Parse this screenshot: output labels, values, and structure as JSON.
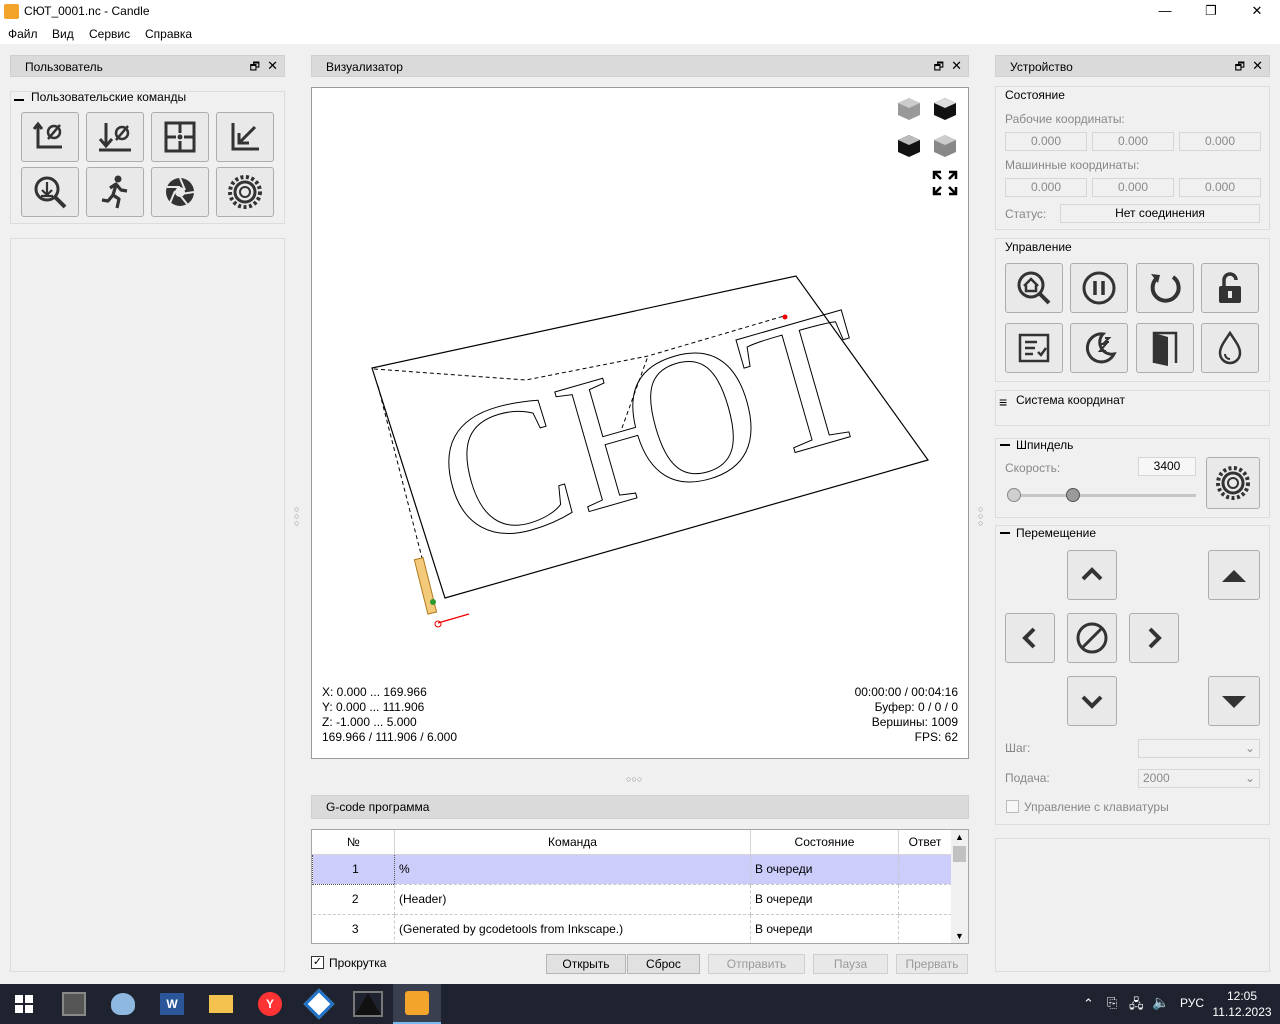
{
  "window": {
    "title": "СЮТ_0001.nc - Candle",
    "min": "—",
    "max": "❐",
    "close": "✕"
  },
  "menu": [
    "Файл",
    "Вид",
    "Сервис",
    "Справка"
  ],
  "user_panel": {
    "title": "Пользователь",
    "group": "Пользовательские команды",
    "float": "🗗",
    "close": "✕"
  },
  "visualizer": {
    "title": "Визуализатор",
    "float": "🗗",
    "close": "✕",
    "text_art": "СЮТ",
    "info_left": [
      "X: 0.000 ... 169.966",
      "Y: 0.000 ... 111.906",
      "Z: -1.000 ... 5.000",
      "169.966 / 111.906 / 6.000"
    ],
    "info_right": [
      "00:00:00 / 00:04:16",
      "Буфер: 0 / 0 / 0",
      "Вершины: 1009",
      "FPS: 62"
    ]
  },
  "gcode": {
    "title": "G-code программа",
    "headers": [
      "№",
      "Команда",
      "Состояние",
      "Ответ"
    ],
    "rows": [
      [
        "1",
        "%",
        "В очереди",
        ""
      ],
      [
        "2",
        "(Header)",
        "В очереди",
        ""
      ],
      [
        "3",
        "(Generated by gcodetools from Inkscape.)",
        "В очереди",
        ""
      ]
    ],
    "scroll_label": "Прокрутка",
    "scroll_checked": true,
    "buttons": {
      "open": "Открыть",
      "reset": "Сброс",
      "send": "Отправить",
      "pause": "Пауза",
      "abort": "Прервать"
    }
  },
  "device": {
    "title": "Устройство",
    "float": "🗗",
    "close": "✕",
    "state": {
      "title": "Состояние",
      "work_label": "Рабочие координаты:",
      "work": [
        "0.000",
        "0.000",
        "0.000"
      ],
      "machine_label": "Машинные координаты:",
      "machine": [
        "0.000",
        "0.000",
        "0.000"
      ],
      "status_label": "Статус:",
      "status": "Нет соединения"
    },
    "control_title": "Управление",
    "coord_title": "Система координат",
    "spindle": {
      "title": "Шпиндель",
      "speed_label": "Скорость:",
      "speed": "3400"
    },
    "move": {
      "title": "Перемещение",
      "step_label": "Шаг:",
      "step": "",
      "feed_label": "Подача:",
      "feed": "2000",
      "keyboard_label": "Управление с клавиатуры"
    }
  },
  "taskbar": {
    "lang": "РУС",
    "time": "12:05",
    "date": "11.12.2023"
  },
  "colors": {
    "highlight": "#cccdfb",
    "accent": "#1f2330"
  }
}
